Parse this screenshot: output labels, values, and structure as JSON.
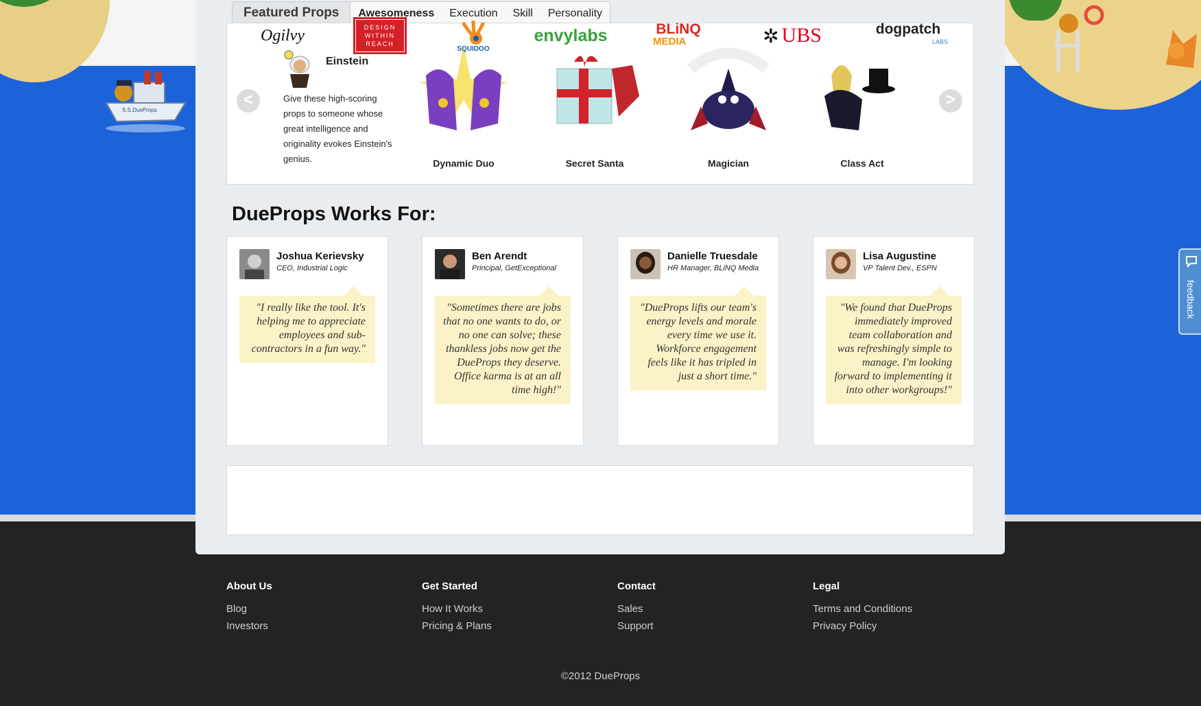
{
  "tabs": {
    "featured": "Featured Props",
    "items": [
      "Awesomeness",
      "Execution",
      "Skill",
      "Personality"
    ]
  },
  "featured_prop": {
    "title": "Einstein",
    "description": "Give these high-scoring props to someone whose great intelligence and originality evokes Einstein's genius."
  },
  "props": [
    "Dynamic Duo",
    "Secret Santa",
    "Magician",
    "Class Act"
  ],
  "arrows": {
    "left": "<",
    "right": ">"
  },
  "works_for": {
    "heading": "DueProps Works For:",
    "testimonials": [
      {
        "name": "Joshua Kerievsky",
        "title": "CEO, Industrial Logic",
        "quote": "\"I really like the tool. It's helping me to appreciate employees and sub-contractors in a fun way.\""
      },
      {
        "name": "Ben Arendt",
        "title": "Principal, GetExceptional",
        "quote": "\"Sometimes there are jobs that no one wants to do, or no one can solve; these thankless jobs now get the DueProps they deserve. Office karma is at an all time high!\""
      },
      {
        "name": "Danielle Truesdale",
        "title": "HR Manager, BLiNQ Media",
        "quote": "\"DueProps lifts our team's energy levels and morale every time we use it. Workforce engagement feels like it has tripled in just a short time.\""
      },
      {
        "name": "Lisa Augustine",
        "title": "VP Talent Dev., ESPN",
        "quote": "\"We found that DueProps immediately improved team collaboration and was refreshingly simple to manage. I'm looking forward to implementing it into other workgroups!\""
      }
    ]
  },
  "logos": {
    "ogilvy": "Ogilvy",
    "dwr": [
      "DESIGN",
      "WITHIN",
      "REACH"
    ],
    "squidoo": "SQUIDOO",
    "envylabs": "envylabs",
    "blinq": [
      "BLiNQ",
      "MEDIA"
    ],
    "ubs": "UBS",
    "dogpatch": [
      "dogpatch",
      "LABS"
    ]
  },
  "ship_label": "S.S.DueProps",
  "footer": {
    "columns": [
      {
        "heading": "About Us",
        "links": [
          "Blog",
          "Investors"
        ]
      },
      {
        "heading": "Get Started",
        "links": [
          "How It Works",
          "Pricing & Plans"
        ]
      },
      {
        "heading": "Contact",
        "links": [
          "Sales",
          "Support"
        ]
      },
      {
        "heading": "Legal",
        "links": [
          "Terms and Conditions",
          "Privacy Policy"
        ]
      }
    ],
    "copyright": "©2012 DueProps"
  },
  "feedback": "feedback",
  "colors": {
    "sea": "#1c63d9",
    "quote_bg": "#fbf2c7",
    "footer_bg": "#232323",
    "feedback_tab": "#4f8fd1"
  }
}
